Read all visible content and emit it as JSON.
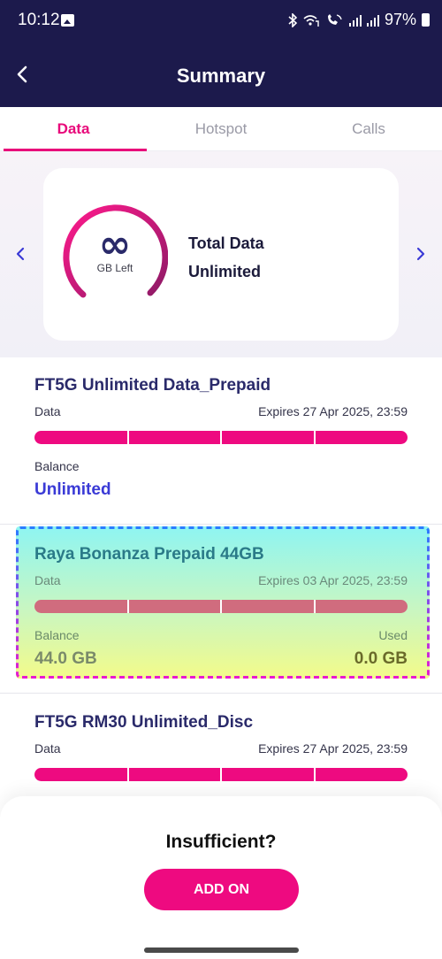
{
  "status_bar": {
    "time": "10:12",
    "battery": "97%",
    "icons": [
      "gallery-icon",
      "bluetooth-icon",
      "wifi-calling-icon",
      "volte-icon",
      "signal-icon",
      "signal-icon",
      "battery-icon"
    ]
  },
  "header": {
    "title": "Summary",
    "back_icon": "chevron-left-icon"
  },
  "tabs": [
    {
      "label": "Data",
      "active": true
    },
    {
      "label": "Hotspot",
      "active": false
    },
    {
      "label": "Calls",
      "active": false
    }
  ],
  "summary_card": {
    "gauge_symbol": "∞",
    "gauge_label": "GB Left",
    "title": "Total Data",
    "value": "Unlimited"
  },
  "plans": [
    {
      "name": "FT5G Unlimited Data_Prepaid",
      "data_label": "Data",
      "expires": "Expires 27 Apr 2025, 23:59",
      "balance_label": "Balance",
      "balance": "Unlimited",
      "bar_color": "#ee0a80"
    },
    {
      "name": "Raya Bonanza Prepaid 44GB",
      "data_label": "Data",
      "expires": "Expires 03 Apr 2025, 23:59",
      "balance_label": "Balance",
      "balance": "44.0 GB",
      "used_label": "Used",
      "used": "0.0 GB",
      "bar_color": "#d06c7e"
    },
    {
      "name": "FT5G RM30 Unlimited_Disc",
      "data_label": "Data",
      "expires": "Expires 27 Apr 2025, 23:59",
      "bar_color": "#ee0a80"
    }
  ],
  "bottom": {
    "question": "Insufficient?",
    "button": "ADD ON"
  },
  "colors": {
    "accent": "#e8087a",
    "navy": "#1c1a4c",
    "balance_blue": "#3a3ad6"
  }
}
